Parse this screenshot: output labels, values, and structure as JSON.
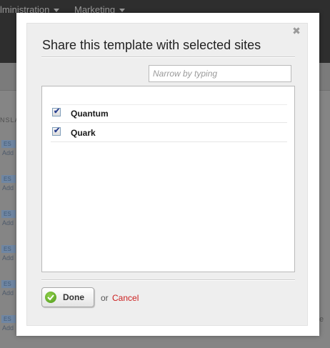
{
  "background": {
    "nav": [
      "lministration",
      "Marketing"
    ],
    "column_label": "NSLA",
    "row_tag": "ES",
    "row_action": "Add",
    "trailing_char": "e"
  },
  "dialog": {
    "title": "Share this template with selected sites",
    "close_icon": "close-icon",
    "filter": {
      "placeholder": "Narrow by typing",
      "value": ""
    },
    "sites": [
      {
        "name": "Quantum",
        "checked": true
      },
      {
        "name": "Quark",
        "checked": true
      }
    ],
    "done_label": "Done",
    "or_text": "or",
    "cancel_label": "Cancel",
    "colors": {
      "cancel": "#cc1f1f",
      "done_icon": "#5aa526",
      "checkbox_check": "#2a3f8f"
    }
  }
}
